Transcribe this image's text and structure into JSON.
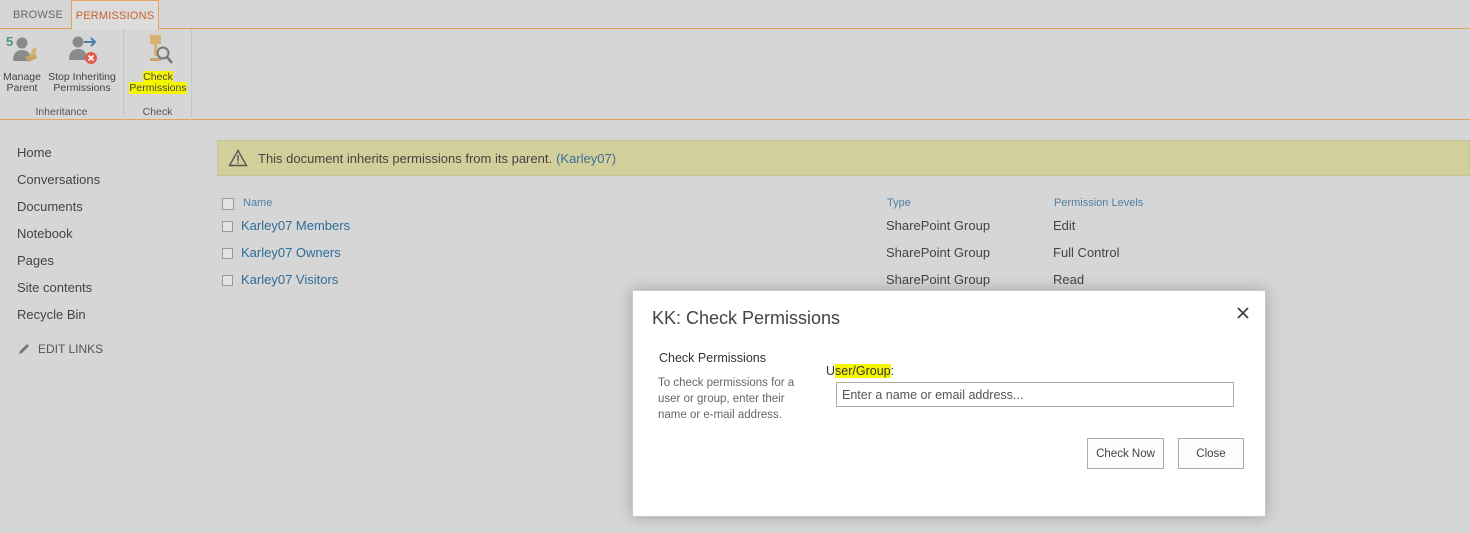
{
  "ribbon": {
    "tabs": [
      {
        "label": "BROWSE",
        "active": false
      },
      {
        "label": "PERMISSIONS",
        "active": true
      }
    ],
    "groups": {
      "inheritance": {
        "label": "Inheritance",
        "manage_parent": {
          "line1": "Manage",
          "line2": "Parent",
          "icon": "manage-parent-icon"
        },
        "stop_inheriting": {
          "line1": "Stop Inheriting",
          "line2": "Permissions",
          "icon": "stop-inheriting-icon"
        }
      },
      "check": {
        "label": "Check",
        "check_permissions": {
          "line1": "Check",
          "line2": "Permissions",
          "icon": "check-permissions-icon"
        }
      }
    }
  },
  "leftnav": {
    "items": [
      "Home",
      "Conversations",
      "Documents",
      "Notebook",
      "Pages",
      "Site contents",
      "Recycle Bin"
    ],
    "edit_links": "EDIT LINKS"
  },
  "banner": {
    "text": "This document inherits permissions from its parent.",
    "link": "(Karley07)"
  },
  "table": {
    "headers": {
      "name": "Name",
      "type": "Type",
      "level": "Permission Levels"
    },
    "rows": [
      {
        "name": "Karley07 Members",
        "type": "SharePoint Group",
        "level": "Edit"
      },
      {
        "name": "Karley07 Owners",
        "type": "SharePoint Group",
        "level": "Full Control"
      },
      {
        "name": "Karley07 Visitors",
        "type": "SharePoint Group",
        "level": "Read"
      }
    ]
  },
  "dialog": {
    "title": "KK: Check Permissions",
    "section_title": "Check Permissions",
    "section_desc": "To check permissions for a user or group, enter their name or e-mail address.",
    "field_label_hl": "User/Group",
    "field_label_rest": ":",
    "field_label_first": "U",
    "input_placeholder": "Enter a name or email address...",
    "input_value": "",
    "check_now": "Check Now",
    "close": "Close"
  },
  "colors": {
    "accent": "#e5a25b",
    "link": "#2e6d99",
    "banner_bg": "#d3cf9b",
    "highlight": "#f6f600"
  }
}
